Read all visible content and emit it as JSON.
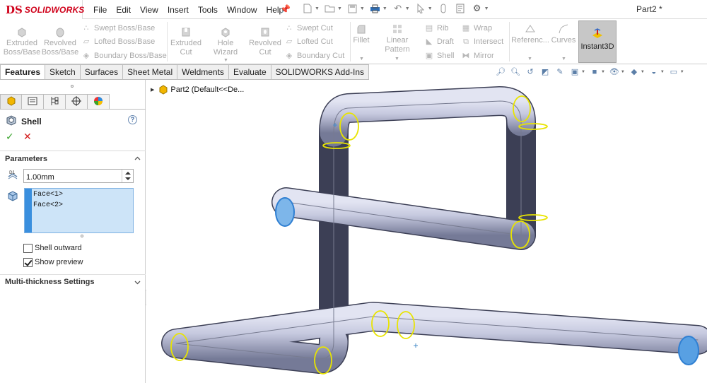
{
  "app": {
    "logo_mark": "DS",
    "logo_name": "SOLIDWORKS",
    "document_title": "Part2 *"
  },
  "menu": [
    "File",
    "Edit",
    "View",
    "Insert",
    "Tools",
    "Window",
    "Help"
  ],
  "quick_toolbar_icons": [
    "new-icon",
    "open-icon",
    "save-icon",
    "print-icon",
    "undo-icon",
    "select-icon",
    "rebuild-icon",
    "file-properties-icon",
    "options-icon"
  ],
  "ribbon": {
    "extruded_boss": "Extruded Boss/Base",
    "revolved_boss": "Revolved Boss/Base",
    "swept_boss": "Swept Boss/Base",
    "lofted_boss": "Lofted Boss/Base",
    "boundary_boss": "Boundary Boss/Base",
    "extruded_cut": "Extruded Cut",
    "hole_wizard": "Hole Wizard",
    "revolved_cut": "Revolved Cut",
    "swept_cut": "Swept Cut",
    "lofted_cut": "Lofted Cut",
    "boundary_cut": "Boundary Cut",
    "fillet": "Fillet",
    "linear_pattern": "Linear Pattern",
    "rib": "Rib",
    "draft": "Draft",
    "shell": "Shell",
    "wrap": "Wrap",
    "intersect": "Intersect",
    "mirror": "Mirror",
    "reference": "Referenc...",
    "curves": "Curves",
    "instant3d": "Instant3D"
  },
  "tabs": [
    "Features",
    "Sketch",
    "Surfaces",
    "Sheet Metal",
    "Weldments",
    "Evaluate",
    "SOLIDWORKS Add-Ins"
  ],
  "view_toolbar_icons": [
    "zoom-to-fit-icon",
    "zoom-to-area-icon",
    "previous-view-icon",
    "section-view-icon",
    "dynamic-annotation-icon",
    "view-orientation-icon",
    "display-style-icon",
    "hide-show-icon",
    "edit-appearance-icon",
    "apply-scene-icon",
    "view-settings-icon",
    "display-pane-icon"
  ],
  "panel": {
    "feature_name": "Shell",
    "help": "?",
    "ok": "✓",
    "cancel": "✕",
    "parameters_label": "Parameters",
    "thickness": "1.00mm",
    "faces": [
      "Face<1>",
      "Face<2>"
    ],
    "shell_outward_label": "Shell outward",
    "shell_outward": false,
    "show_preview_label": "Show preview",
    "show_preview": true,
    "multi_thickness_label": "Multi-thickness Settings"
  },
  "tree": {
    "root_label": "Part2  (Default<<De..."
  },
  "colors": {
    "accent": "#3a8fde",
    "selection_box": "#cde4f8",
    "edge_highlight": "#e8e400",
    "pipe": "#c4c7df",
    "ok": "#3aa52c",
    "cancel": "#d42020"
  }
}
